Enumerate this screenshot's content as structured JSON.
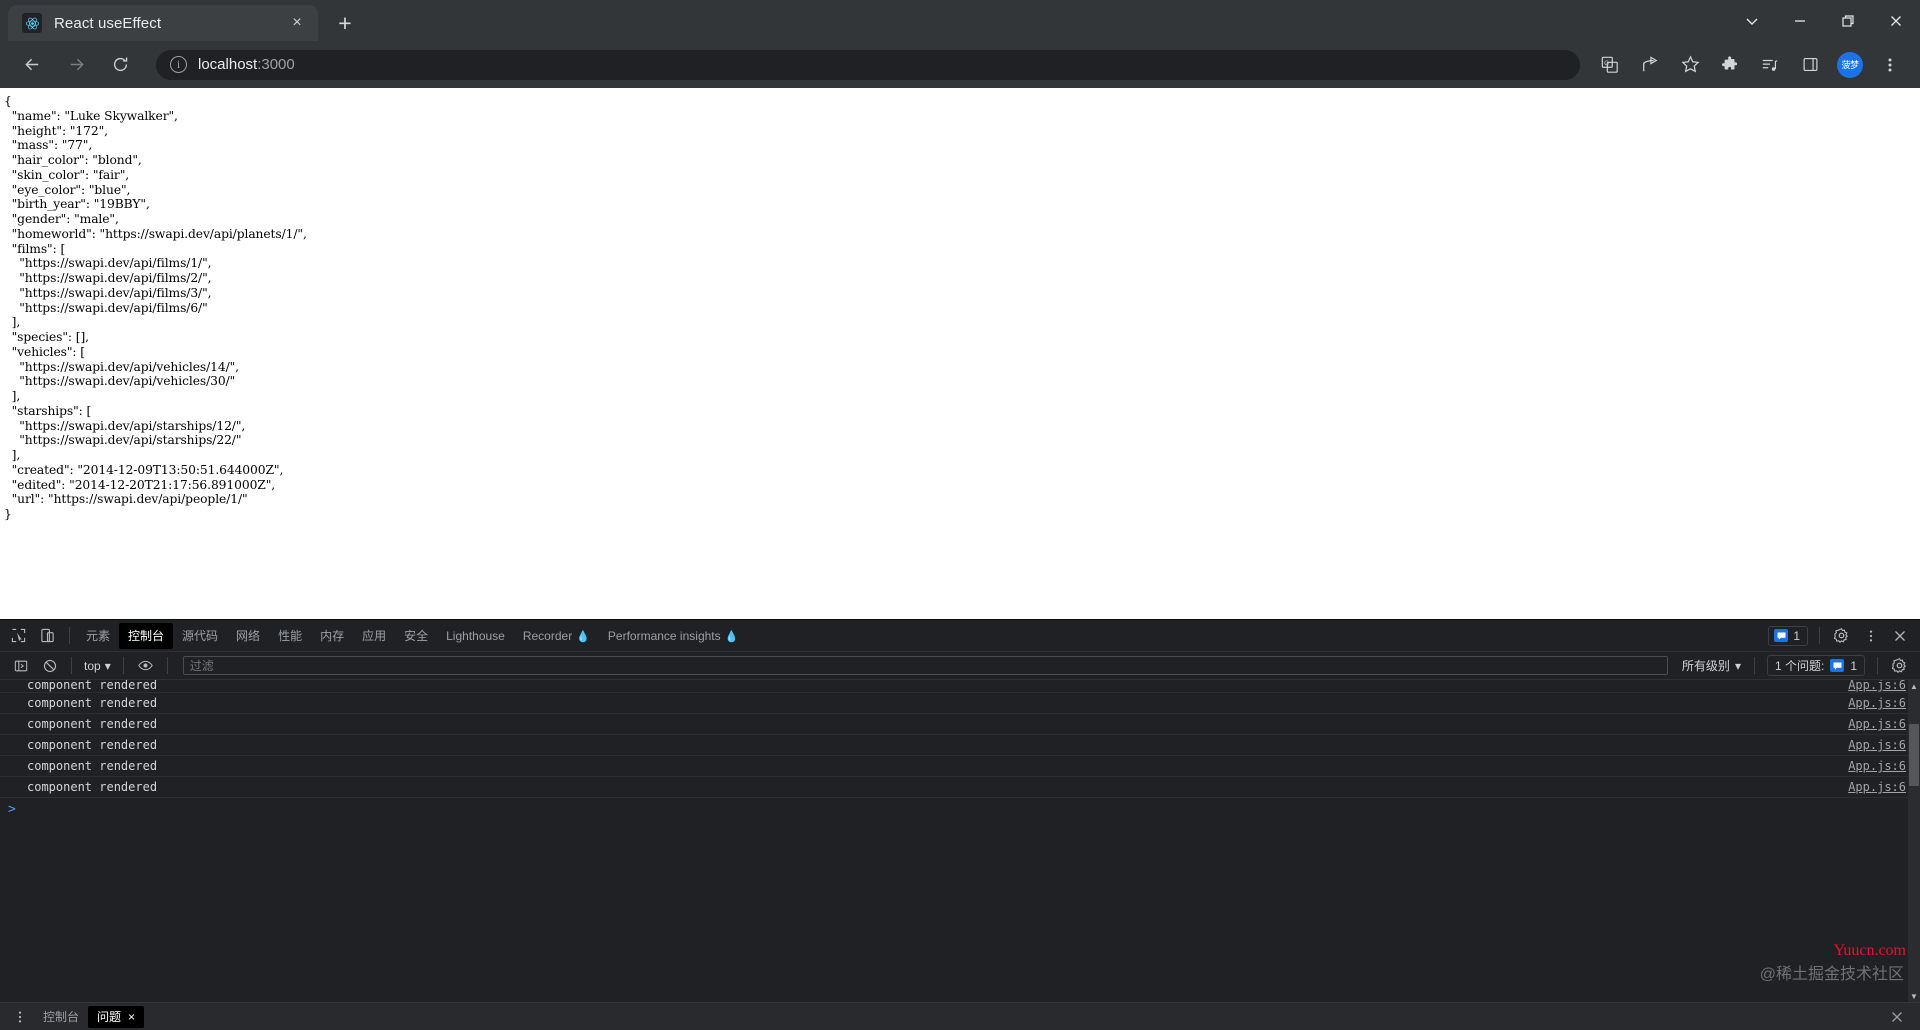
{
  "browser": {
    "tab": {
      "title": "React useEffect",
      "favicon": "react-logo-icon",
      "close": "×"
    },
    "new_tab_label": "+",
    "window_controls": [
      "tab-search-chevron",
      "minimize",
      "restore",
      "close"
    ],
    "nav": {
      "back": "back-arrow",
      "forward": "forward-arrow",
      "reload": "reload-arrow"
    },
    "omnibox": {
      "info_icon": "i",
      "url_host": "localhost",
      "url_port": ":3000",
      "full_url": "localhost:3000"
    },
    "toolbar_icons": [
      "translate-icon",
      "share-icon",
      "bookmark-star-icon",
      "extensions-puzzle-icon",
      "reading-list-icon",
      "side-panel-icon"
    ],
    "avatar_label": "菠梦",
    "menu_icon": "kebab-menu-icon"
  },
  "page": {
    "json_text": "{\n  \"name\": \"Luke Skywalker\",\n  \"height\": \"172\",\n  \"mass\": \"77\",\n  \"hair_color\": \"blond\",\n  \"skin_color\": \"fair\",\n  \"eye_color\": \"blue\",\n  \"birth_year\": \"19BBY\",\n  \"gender\": \"male\",\n  \"homeworld\": \"https://swapi.dev/api/planets/1/\",\n  \"films\": [\n    \"https://swapi.dev/api/films/1/\",\n    \"https://swapi.dev/api/films/2/\",\n    \"https://swapi.dev/api/films/3/\",\n    \"https://swapi.dev/api/films/6/\"\n  ],\n  \"species\": [],\n  \"vehicles\": [\n    \"https://swapi.dev/api/vehicles/14/\",\n    \"https://swapi.dev/api/vehicles/30/\"\n  ],\n  \"starships\": [\n    \"https://swapi.dev/api/starships/12/\",\n    \"https://swapi.dev/api/starships/22/\"\n  ],\n  \"created\": \"2014-12-09T13:50:51.644000Z\",\n  \"edited\": \"2014-12-20T21:17:56.891000Z\",\n  \"url\": \"https://swapi.dev/api/people/1/\"\n}",
    "json_object": {
      "name": "Luke Skywalker",
      "height": "172",
      "mass": "77",
      "hair_color": "blond",
      "skin_color": "fair",
      "eye_color": "blue",
      "birth_year": "19BBY",
      "gender": "male",
      "homeworld": "https://swapi.dev/api/planets/1/",
      "films": [
        "https://swapi.dev/api/films/1/",
        "https://swapi.dev/api/films/2/",
        "https://swapi.dev/api/films/3/",
        "https://swapi.dev/api/films/6/"
      ],
      "species": [],
      "vehicles": [
        "https://swapi.dev/api/vehicles/14/",
        "https://swapi.dev/api/vehicles/30/"
      ],
      "starships": [
        "https://swapi.dev/api/starships/12/",
        "https://swapi.dev/api/starships/22/"
      ],
      "created": "2014-12-09T13:50:51.644000Z",
      "edited": "2014-12-20T21:17:56.891000Z",
      "url": "https://swapi.dev/api/people/1/"
    }
  },
  "devtools": {
    "inspect_icon": "inspect-element-icon",
    "device_icon": "device-toolbar-icon",
    "tabs": [
      {
        "label": "元素",
        "active": false,
        "flask": false
      },
      {
        "label": "控制台",
        "active": true,
        "flask": false
      },
      {
        "label": "源代码",
        "active": false,
        "flask": false
      },
      {
        "label": "网络",
        "active": false,
        "flask": false
      },
      {
        "label": "性能",
        "active": false,
        "flask": false
      },
      {
        "label": "内存",
        "active": false,
        "flask": false
      },
      {
        "label": "应用",
        "active": false,
        "flask": false
      },
      {
        "label": "安全",
        "active": false,
        "flask": false
      },
      {
        "label": "Lighthouse",
        "active": false,
        "flask": false
      },
      {
        "label": "Recorder",
        "active": false,
        "flask": true
      },
      {
        "label": "Performance insights",
        "active": false,
        "flask": true
      }
    ],
    "message_count": "1",
    "settings_icon": "gear-icon",
    "more_icon": "kebab-menu-icon",
    "close_icon": "close-icon",
    "console_bar": {
      "sidebar_toggle": "console-sidebar-icon",
      "clear_icon": "clear-console-icon",
      "context": "top",
      "eye_icon": "live-expression-eye-icon",
      "filter_placeholder": "过滤",
      "filter_value": "",
      "level": "所有级别",
      "issues_label": "1 个问题:",
      "issues_count": "1",
      "settings_icon": "gear-icon"
    },
    "logs": [
      {
        "message": "component rendered",
        "source": "App.js:6"
      },
      {
        "message": "component rendered",
        "source": "App.js:6"
      },
      {
        "message": "component rendered",
        "source": "App.js:6"
      },
      {
        "message": "component rendered",
        "source": "App.js:6"
      },
      {
        "message": "component rendered",
        "source": "App.js:6"
      },
      {
        "message": "component rendered",
        "source": "App.js:6"
      }
    ],
    "prompt": ">",
    "drawer": {
      "more_icon": "kebab-menu-icon",
      "tabs": [
        {
          "label": "控制台",
          "active": false,
          "closable": false
        },
        {
          "label": "问题",
          "active": true,
          "closable": true
        }
      ],
      "close_label": "×",
      "drawer_close_icon": "close-icon"
    }
  },
  "watermarks": {
    "red": "Yuucn.com",
    "gray": "@稀土掘金技术社区"
  },
  "colors": {
    "accent_blue": "#1a73e8",
    "chrome_bg": "#323639",
    "devtools_bg": "#202124",
    "watermark_red": "#e8112d"
  }
}
